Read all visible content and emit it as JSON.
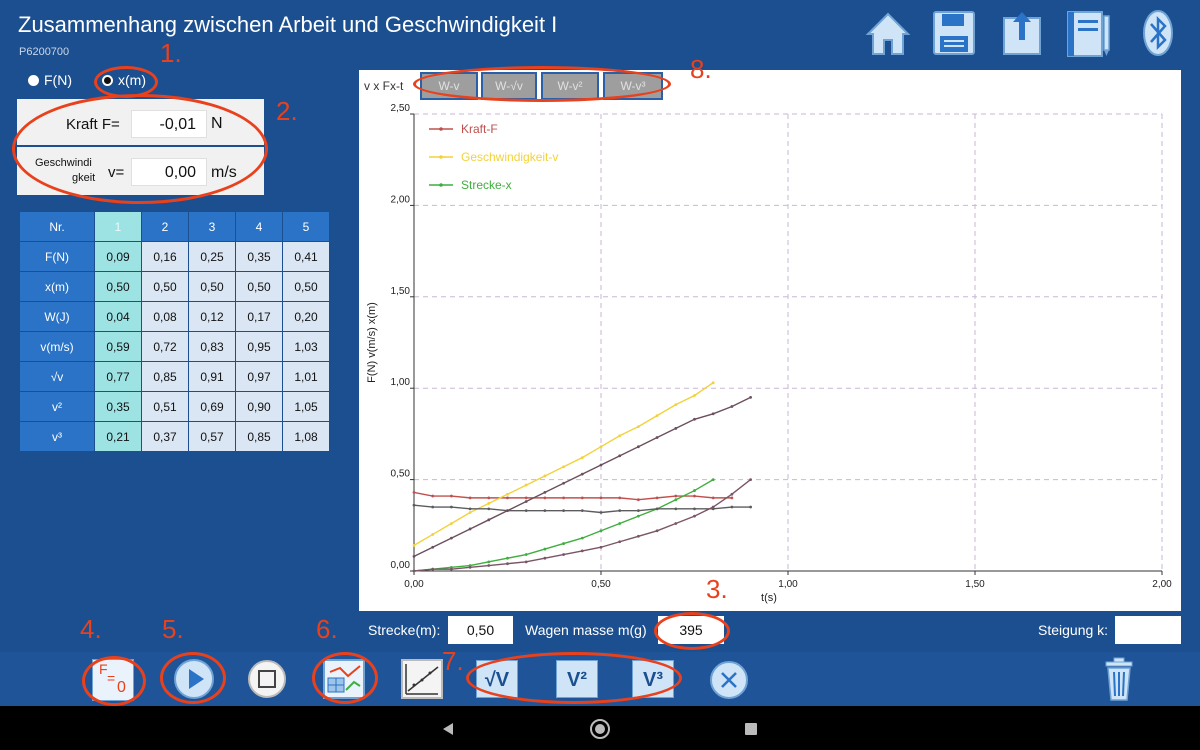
{
  "header": {
    "title": "Zusammenhang zwischen Arbeit und Geschwindigkeit I",
    "code": "P6200700",
    "icons": [
      "home-icon",
      "save-icon",
      "share-icon",
      "notebook-icon",
      "bluetooth-icon"
    ]
  },
  "mode": {
    "options": [
      {
        "label": "F(N)",
        "selected": false
      },
      {
        "label": "x(m)",
        "selected": true
      }
    ]
  },
  "readings": {
    "force_label": "Kraft F=",
    "force_value": "-0,01",
    "force_unit": "N",
    "speed_label_1": "Geschwindi",
    "speed_label_2": "gkeit",
    "speed_symbol": "v=",
    "speed_value": "0,00",
    "speed_unit": "m/s"
  },
  "table": {
    "corner": "Nr.",
    "columns": [
      "1",
      "2",
      "3",
      "4",
      "5"
    ],
    "selected_column": 0,
    "rows": [
      {
        "label": "F(N)",
        "values": [
          "0,09",
          "0,16",
          "0,25",
          "0,35",
          "0,41"
        ]
      },
      {
        "label": "x(m)",
        "values": [
          "0,50",
          "0,50",
          "0,50",
          "0,50",
          "0,50"
        ]
      },
      {
        "label": "W(J)",
        "values": [
          "0,04",
          "0,08",
          "0,12",
          "0,17",
          "0,20"
        ]
      },
      {
        "label": "v(m/s)",
        "values": [
          "0,59",
          "0,72",
          "0,83",
          "0,95",
          "1,03"
        ]
      },
      {
        "label": "√v",
        "values": [
          "0,77",
          "0,85",
          "0,91",
          "0,97",
          "1,01"
        ]
      },
      {
        "label": "v²",
        "values": [
          "0,35",
          "0,51",
          "0,69",
          "0,90",
          "1,05"
        ]
      },
      {
        "label": "v³",
        "values": [
          "0,21",
          "0,37",
          "0,57",
          "0,85",
          "1,08"
        ]
      }
    ]
  },
  "chart_tabs": {
    "label": "v x Fx-t",
    "tabs": [
      "W-v",
      "W-√v",
      "W-v²",
      "W-v³"
    ]
  },
  "chart_data": {
    "type": "line",
    "xlabel": "t(s)",
    "ylabel": "F(N) v(m/s) x(m)",
    "xlim": [
      0,
      2
    ],
    "ylim": [
      0,
      2.5
    ],
    "xticks": [
      "0,00",
      "0,50",
      "1,00",
      "1,50",
      "2,00"
    ],
    "yticks": [
      "0,00",
      "0,50",
      "1,00",
      "1,50",
      "2,00",
      "2,50"
    ],
    "xtick_values": [
      0,
      0.5,
      1,
      1.5,
      2
    ],
    "ytick_values": [
      0,
      0.5,
      1,
      1.5,
      2,
      2.5
    ],
    "grid": true,
    "legend_position": "top-left",
    "series": [
      {
        "name": "Kraft-F",
        "color": "#c0504d",
        "x": [
          0,
          0.05,
          0.1,
          0.15,
          0.2,
          0.25,
          0.3,
          0.35,
          0.4,
          0.45,
          0.5,
          0.55,
          0.6,
          0.65,
          0.7,
          0.75,
          0.8,
          0.85
        ],
        "y": [
          0.43,
          0.41,
          0.41,
          0.4,
          0.4,
          0.4,
          0.4,
          0.4,
          0.4,
          0.4,
          0.4,
          0.4,
          0.39,
          0.4,
          0.41,
          0.41,
          0.4,
          0.4
        ]
      },
      {
        "name": "Geschwindigkeit-v",
        "color": "#f2d23c",
        "x": [
          0,
          0.05,
          0.1,
          0.15,
          0.2,
          0.25,
          0.3,
          0.35,
          0.4,
          0.45,
          0.5,
          0.55,
          0.6,
          0.65,
          0.7,
          0.75,
          0.8
        ],
        "y": [
          0.14,
          0.2,
          0.26,
          0.32,
          0.37,
          0.42,
          0.47,
          0.52,
          0.57,
          0.62,
          0.68,
          0.74,
          0.79,
          0.85,
          0.91,
          0.96,
          1.03
        ]
      },
      {
        "name": "Strecke-x",
        "color": "#3fae3f",
        "x": [
          0,
          0.05,
          0.1,
          0.15,
          0.2,
          0.25,
          0.3,
          0.35,
          0.4,
          0.45,
          0.5,
          0.55,
          0.6,
          0.65,
          0.7,
          0.75,
          0.8
        ],
        "y": [
          0.0,
          0.01,
          0.02,
          0.03,
          0.05,
          0.07,
          0.09,
          0.12,
          0.15,
          0.18,
          0.22,
          0.26,
          0.3,
          0.34,
          0.39,
          0.44,
          0.5
        ]
      },
      {
        "name": "",
        "color": "#5c5c5c",
        "x": [
          0,
          0.05,
          0.1,
          0.15,
          0.2,
          0.25,
          0.3,
          0.35,
          0.4,
          0.45,
          0.5,
          0.55,
          0.6,
          0.65,
          0.7,
          0.75,
          0.8,
          0.85,
          0.9
        ],
        "y": [
          0.36,
          0.35,
          0.35,
          0.34,
          0.34,
          0.33,
          0.33,
          0.33,
          0.33,
          0.33,
          0.32,
          0.33,
          0.33,
          0.34,
          0.34,
          0.34,
          0.34,
          0.35,
          0.35
        ]
      },
      {
        "name": "",
        "color": "#6b4f5e",
        "x": [
          0,
          0.05,
          0.1,
          0.15,
          0.2,
          0.25,
          0.3,
          0.35,
          0.4,
          0.45,
          0.5,
          0.55,
          0.6,
          0.65,
          0.7,
          0.75,
          0.8,
          0.85,
          0.9
        ],
        "y": [
          0.08,
          0.13,
          0.18,
          0.23,
          0.28,
          0.33,
          0.38,
          0.43,
          0.48,
          0.53,
          0.58,
          0.63,
          0.68,
          0.73,
          0.78,
          0.83,
          0.86,
          0.9,
          0.95
        ]
      },
      {
        "name": "",
        "color": "#7a5565",
        "x": [
          0,
          0.05,
          0.1,
          0.15,
          0.2,
          0.25,
          0.3,
          0.35,
          0.4,
          0.45,
          0.5,
          0.55,
          0.6,
          0.65,
          0.7,
          0.75,
          0.8,
          0.85,
          0.9
        ],
        "y": [
          0.0,
          0.01,
          0.01,
          0.02,
          0.03,
          0.04,
          0.05,
          0.07,
          0.09,
          0.11,
          0.13,
          0.16,
          0.19,
          0.22,
          0.26,
          0.3,
          0.35,
          0.42,
          0.5
        ]
      }
    ]
  },
  "bottom": {
    "strecke_label": "Strecke(m):",
    "strecke_value": "0,50",
    "masse_label": "Wagen masse m(g)",
    "masse_value": "395",
    "steigung_label": "Steigung k:",
    "steigung_value": ""
  },
  "toolbar": {
    "zero_label": "F",
    "zero_sub": "0",
    "zero_eq": "=",
    "sqrt_label": "√V",
    "sq_label": "V²",
    "cube_label": "V³",
    "icons": [
      "zero-force-icon",
      "play-icon",
      "stop-icon",
      "chart-table-icon",
      "linear-fit-icon",
      "sqrt-v-icon",
      "v-squared-icon",
      "v-cubed-icon",
      "close-icon",
      "trash-icon"
    ]
  },
  "annotations": [
    "1.",
    "2.",
    "3.",
    "4.",
    "5.",
    "6.",
    "7.",
    "8."
  ],
  "colors": {
    "background": "#1c4f8f",
    "accent": "#2b73c6",
    "selected": "#9ee3e4",
    "annotation": "#e8411c"
  }
}
